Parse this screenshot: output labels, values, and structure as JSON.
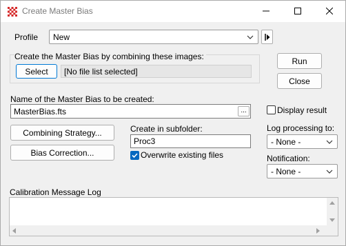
{
  "window": {
    "title": "Create Master Bias",
    "minimize_icon": "minimize-icon",
    "maximize_icon": "maximize-icon",
    "close_icon": "close-icon"
  },
  "profile": {
    "label": "Profile",
    "value": "New",
    "arrow_icon": "play-arrow-icon"
  },
  "combine_group": {
    "label": "Create the Master Bias by combining these images:",
    "select_label": "Select",
    "file_list_text": "[No file list selected]"
  },
  "actions": {
    "run_label": "Run",
    "close_label": "Close"
  },
  "output": {
    "name_label": "Name of the Master Bias to be created:",
    "name_value": "MasterBias.fts",
    "browse_label": "...",
    "display_result_label": "Display result",
    "display_result_checked": false
  },
  "buttons": {
    "combining_strategy": "Combining Strategy...",
    "bias_correction": "Bias Correction..."
  },
  "subfolder": {
    "label": "Create in subfolder:",
    "value": "Proc3",
    "overwrite_label": "Overwrite existing files",
    "overwrite_checked": true
  },
  "log_processing": {
    "label": "Log processing to:",
    "value": "- None -"
  },
  "notification": {
    "label": "Notification:",
    "value": "- None -"
  },
  "message_log": {
    "label": "Calibration Message Log"
  },
  "colors": {
    "accent": "#0078d4",
    "app_icon": "#d62a2a"
  }
}
